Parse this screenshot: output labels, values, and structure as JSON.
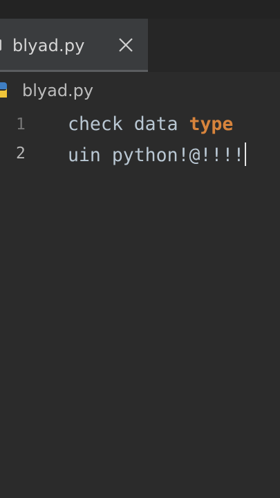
{
  "tab": {
    "label": "blyad.py",
    "close_icon": "close-icon"
  },
  "breadcrumb": {
    "icon": "python-file-icon",
    "label": "blyad.py"
  },
  "editor": {
    "lines": [
      {
        "number": "1",
        "text": "check data ",
        "keyword": "type"
      },
      {
        "number": "2",
        "text": "uin python!@!!!!",
        "keyword": ""
      }
    ]
  },
  "colors": {
    "background": "#2b2b2b",
    "tab_active": "#3a3c3e",
    "text": "#b9c7d3",
    "keyword": "#d8843c",
    "line_number": "#767676"
  }
}
